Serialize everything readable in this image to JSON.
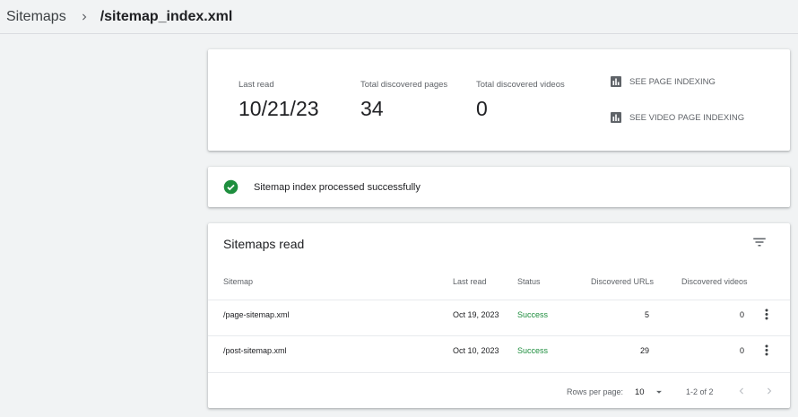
{
  "breadcrumb": {
    "root": "Sitemaps",
    "current": "/sitemap_index.xml"
  },
  "summary": {
    "last_read_label": "Last read",
    "last_read_value": "10/21/23",
    "pages_label": "Total discovered pages",
    "pages_value": "34",
    "videos_label": "Total discovered videos",
    "videos_value": "0",
    "page_indexing_link": "SEE PAGE INDEXING",
    "video_indexing_link": "SEE VIDEO PAGE INDEXING"
  },
  "status": {
    "message": "Sitemap index processed successfully",
    "color": "#1e8e3e"
  },
  "table": {
    "title": "Sitemaps read",
    "headers": {
      "sitemap": "Sitemap",
      "last_read": "Last read",
      "status": "Status",
      "urls": "Discovered URLs",
      "videos": "Discovered videos"
    },
    "rows": [
      {
        "sitemap": "/page-sitemap.xml",
        "last_read": "Oct 19, 2023",
        "status": "Success",
        "urls": "5",
        "videos": "0"
      },
      {
        "sitemap": "/post-sitemap.xml",
        "last_read": "Oct 10, 2023",
        "status": "Success",
        "urls": "29",
        "videos": "0"
      }
    ],
    "footer": {
      "rows_per_page_label": "Rows per page:",
      "rows_per_page_value": "10",
      "range": "1-2 of 2"
    }
  },
  "icons": {
    "breadcrumb_separator": "chevron-right-icon",
    "link": "bar-chart-icon",
    "status": "check-circle-icon",
    "filter": "filter-icon",
    "row_menu": "more-vert-icon",
    "dropdown": "arrow-drop-down-icon",
    "prev": "chevron-left-icon",
    "next": "chevron-right-icon"
  }
}
